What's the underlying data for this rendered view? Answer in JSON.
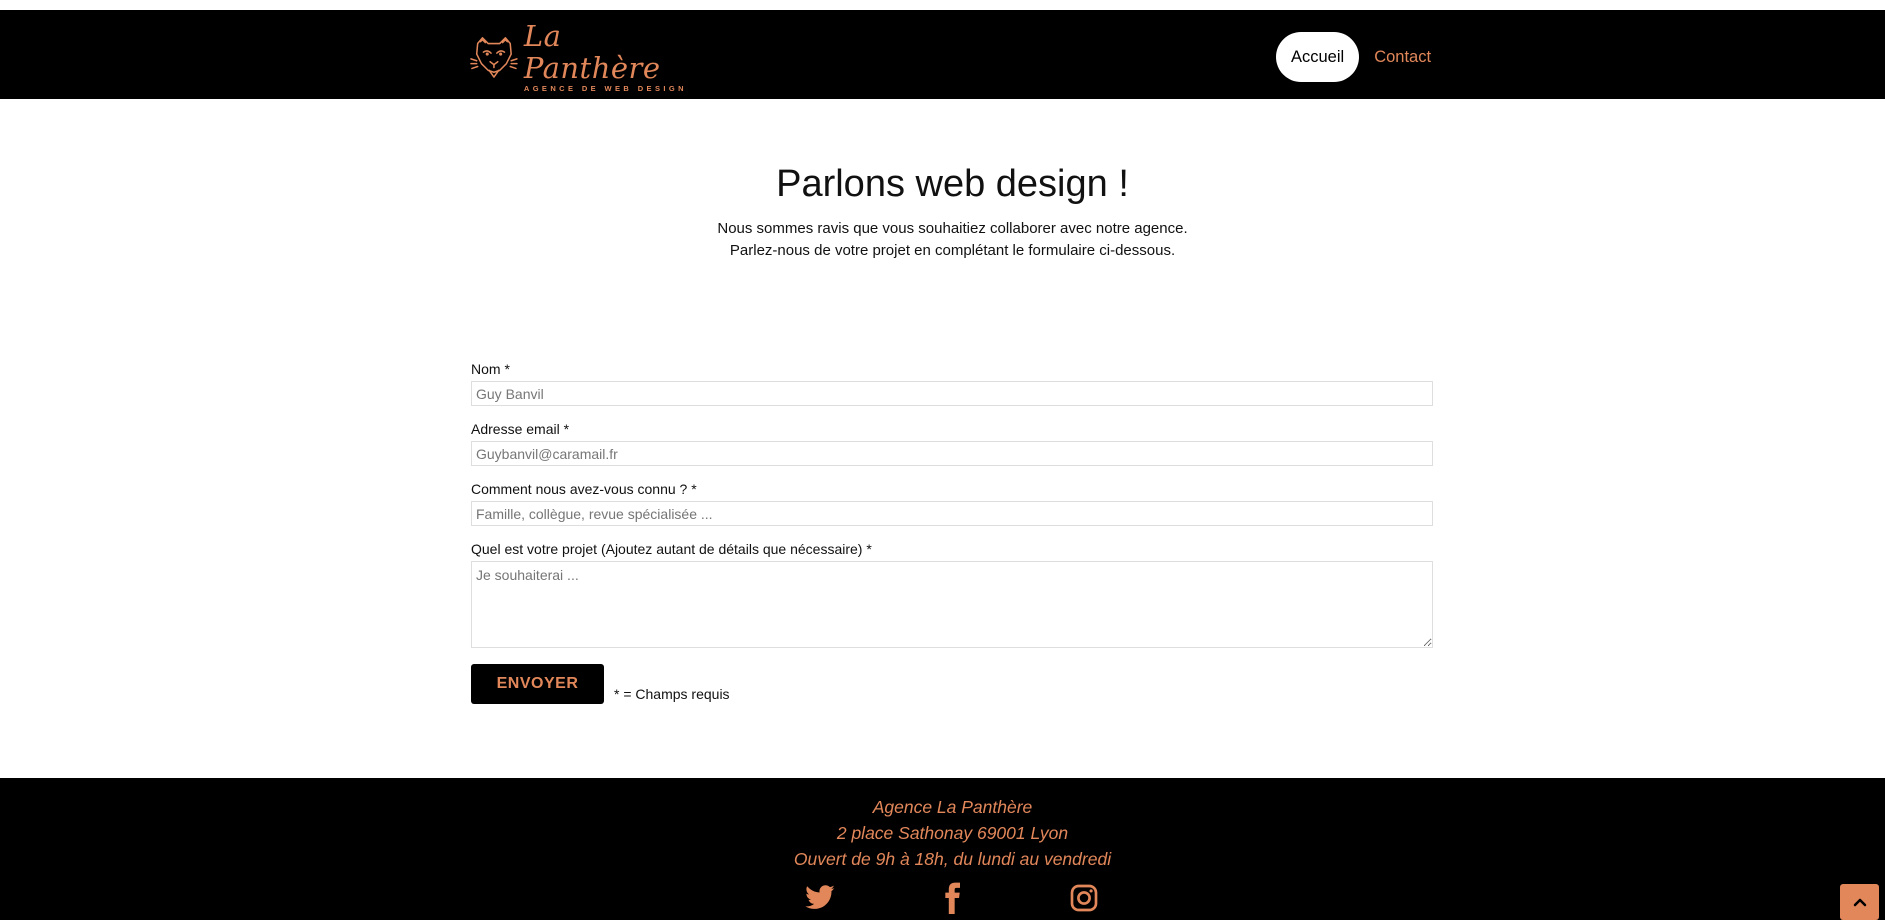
{
  "brand": {
    "name": "La Panthère",
    "tagline": "AGENCE DE WEB DESIGN",
    "accent_color": "#e2875a",
    "logo_icon": "panther-icon"
  },
  "nav": {
    "items": [
      {
        "label": "Accueil",
        "active": true
      },
      {
        "label": "Contact",
        "active": false
      }
    ]
  },
  "main": {
    "title": "Parlons web design !",
    "intro_lines": [
      "Nous sommes ravis que vous souhaitiez collaborer avec notre agence.",
      "Parlez-nous de votre projet en complétant le formulaire ci-dessous."
    ]
  },
  "form": {
    "name": {
      "label": "Nom *",
      "value": "Guy Banvil",
      "placeholder": ""
    },
    "email": {
      "label": "Adresse email *",
      "value": "Guybanvil@caramail.fr",
      "placeholder": ""
    },
    "source": {
      "label": "Comment nous avez-vous connu ? *",
      "value": "",
      "placeholder": "Famille, collègue, revue spécialisée ..."
    },
    "project": {
      "label": "Quel est votre projet (Ajoutez autant de détails que nécessaire) *",
      "value": "",
      "placeholder": "Je souhaiterai ..."
    },
    "submit_label": "ENVOYER",
    "required_note": "* = Champs requis"
  },
  "footer": {
    "lines": [
      "Agence La Panthère",
      "2 place Sathonay 69001 Lyon",
      "Ouvert de 9h à 18h, du lundi au vendredi"
    ],
    "social_icons": [
      "twitter-icon",
      "facebook-icon",
      "instagram-icon"
    ]
  },
  "scroll_top_icon": "chevron-up-icon"
}
